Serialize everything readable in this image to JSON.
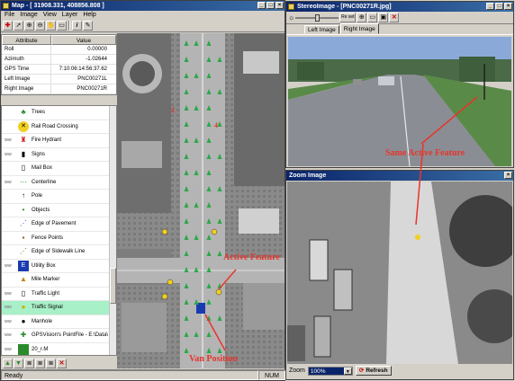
{
  "map_window": {
    "title": "Map - [ 31908.331, 408856.808 ]",
    "menu": [
      "File",
      "Image",
      "View",
      "Layer",
      "Help"
    ]
  },
  "attributes": {
    "header_attribute": "Attribute",
    "header_value": "Value",
    "rows": [
      {
        "key": "Roll",
        "value": "0.00000"
      },
      {
        "key": "Azimuth",
        "value": "-1.02644"
      },
      {
        "key": "GPS Time",
        "value": "7:10:06:14:56:37.62"
      },
      {
        "key": "Left Image",
        "value": "PNC00271L"
      },
      {
        "key": "Right Image",
        "value": "PNC00271R"
      }
    ]
  },
  "layers": [
    {
      "label": "Trees",
      "visible": false
    },
    {
      "label": "Rail Road Crossing",
      "visible": false
    },
    {
      "label": "Fire Hydrant",
      "visible": true
    },
    {
      "label": "Signs",
      "visible": true
    },
    {
      "label": "Mail Box",
      "visible": false
    },
    {
      "label": "Centerline",
      "visible": true
    },
    {
      "label": "Pole",
      "visible": false
    },
    {
      "label": "Objects",
      "visible": false
    },
    {
      "label": "Edge of Pavement",
      "visible": false
    },
    {
      "label": "Fence Points",
      "visible": false
    },
    {
      "label": "Edge of Sidewalk Line",
      "visible": false
    },
    {
      "label": "Utility Box",
      "visible": true
    },
    {
      "label": "Mile Marker",
      "visible": false
    },
    {
      "label": "Traffic Light",
      "visible": true
    },
    {
      "label": "Traffic Signal",
      "visible": true,
      "selected": true
    },
    {
      "label": "Manhole",
      "visible": true
    },
    {
      "label": "GPSVision's PointFile - E:\\Data\\",
      "visible": true
    },
    {
      "label": "20_r.M",
      "visible": true
    }
  ],
  "status": {
    "left": "Ready",
    "right": "NUM"
  },
  "stereo_window": {
    "title": "StereoImage - [PNC00271R.jpg]",
    "tabs": [
      "Left Image",
      "Right Image"
    ],
    "active_tab": "Right Image",
    "reset_label": "Re set"
  },
  "zoom_window": {
    "title": "Zoom Image",
    "zoom_label": "Zoom",
    "zoom_value": "100%",
    "refresh_label": "Refresh"
  },
  "annotations": {
    "active_feature": "Active Feature",
    "same_active_feature": "Same Active Feature",
    "van_position": "Van Position"
  },
  "map_labels": {
    "n2": "2",
    "n4": "4"
  },
  "colors": {
    "title_start": "#0a246a",
    "title_end": "#3a6ea5",
    "annotation": "#e8342c",
    "selected_layer": "#a8f0c8",
    "marker_green": "#2aa84a"
  },
  "icons": [
    "plus-icon",
    "arrow-icon",
    "zoom-in-icon",
    "zoom-out-icon",
    "pan-icon",
    "close-icon"
  ]
}
